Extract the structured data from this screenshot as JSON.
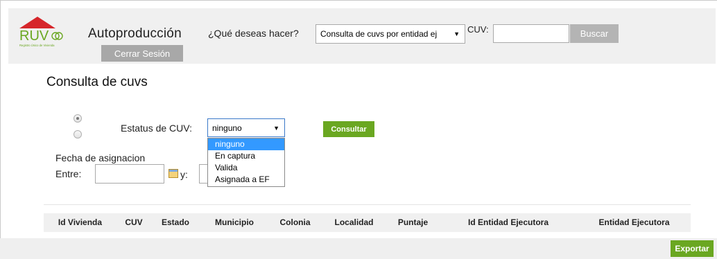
{
  "header": {
    "logo_text": "RUV",
    "logo_subtext": "Registro Único de Vivienda",
    "app_title": "Autoproducción",
    "question_label": "¿Qué deseas hacer?",
    "action_selected": "Consulta de cuvs por entidad ej",
    "cuv_label": "CUV:",
    "cuv_value": "",
    "search_button": "Buscar",
    "logout_button": "Cerrar Sesión"
  },
  "main": {
    "title": "Consulta de cuvs",
    "radio_options": [
      {
        "checked": true
      },
      {
        "checked": false
      }
    ],
    "status_label": "Estatus de CUV:",
    "status_selected": "ninguno",
    "status_options": [
      "ninguno",
      "En captura",
      "Valida",
      "Asignada a EF"
    ],
    "consult_button": "Consultar",
    "date_label": "Fecha de asignacion",
    "between_label": "Entre:",
    "and_label": "y:",
    "date_from": "",
    "date_to": ""
  },
  "table": {
    "columns": [
      "Id Vivienda",
      "CUV",
      "Estado",
      "Municipio",
      "Colonia",
      "Localidad",
      "Puntaje",
      "Id Entidad Ejecutora",
      "Entidad Ejecutora"
    ]
  },
  "footer": {
    "export_button": "Exportar"
  },
  "colors": {
    "brand_green": "#6aa721",
    "logo_red": "#d6262b",
    "header_bg": "#f0f0f0",
    "button_gray": "#b4b4b4",
    "selection_blue": "#3399ff"
  }
}
